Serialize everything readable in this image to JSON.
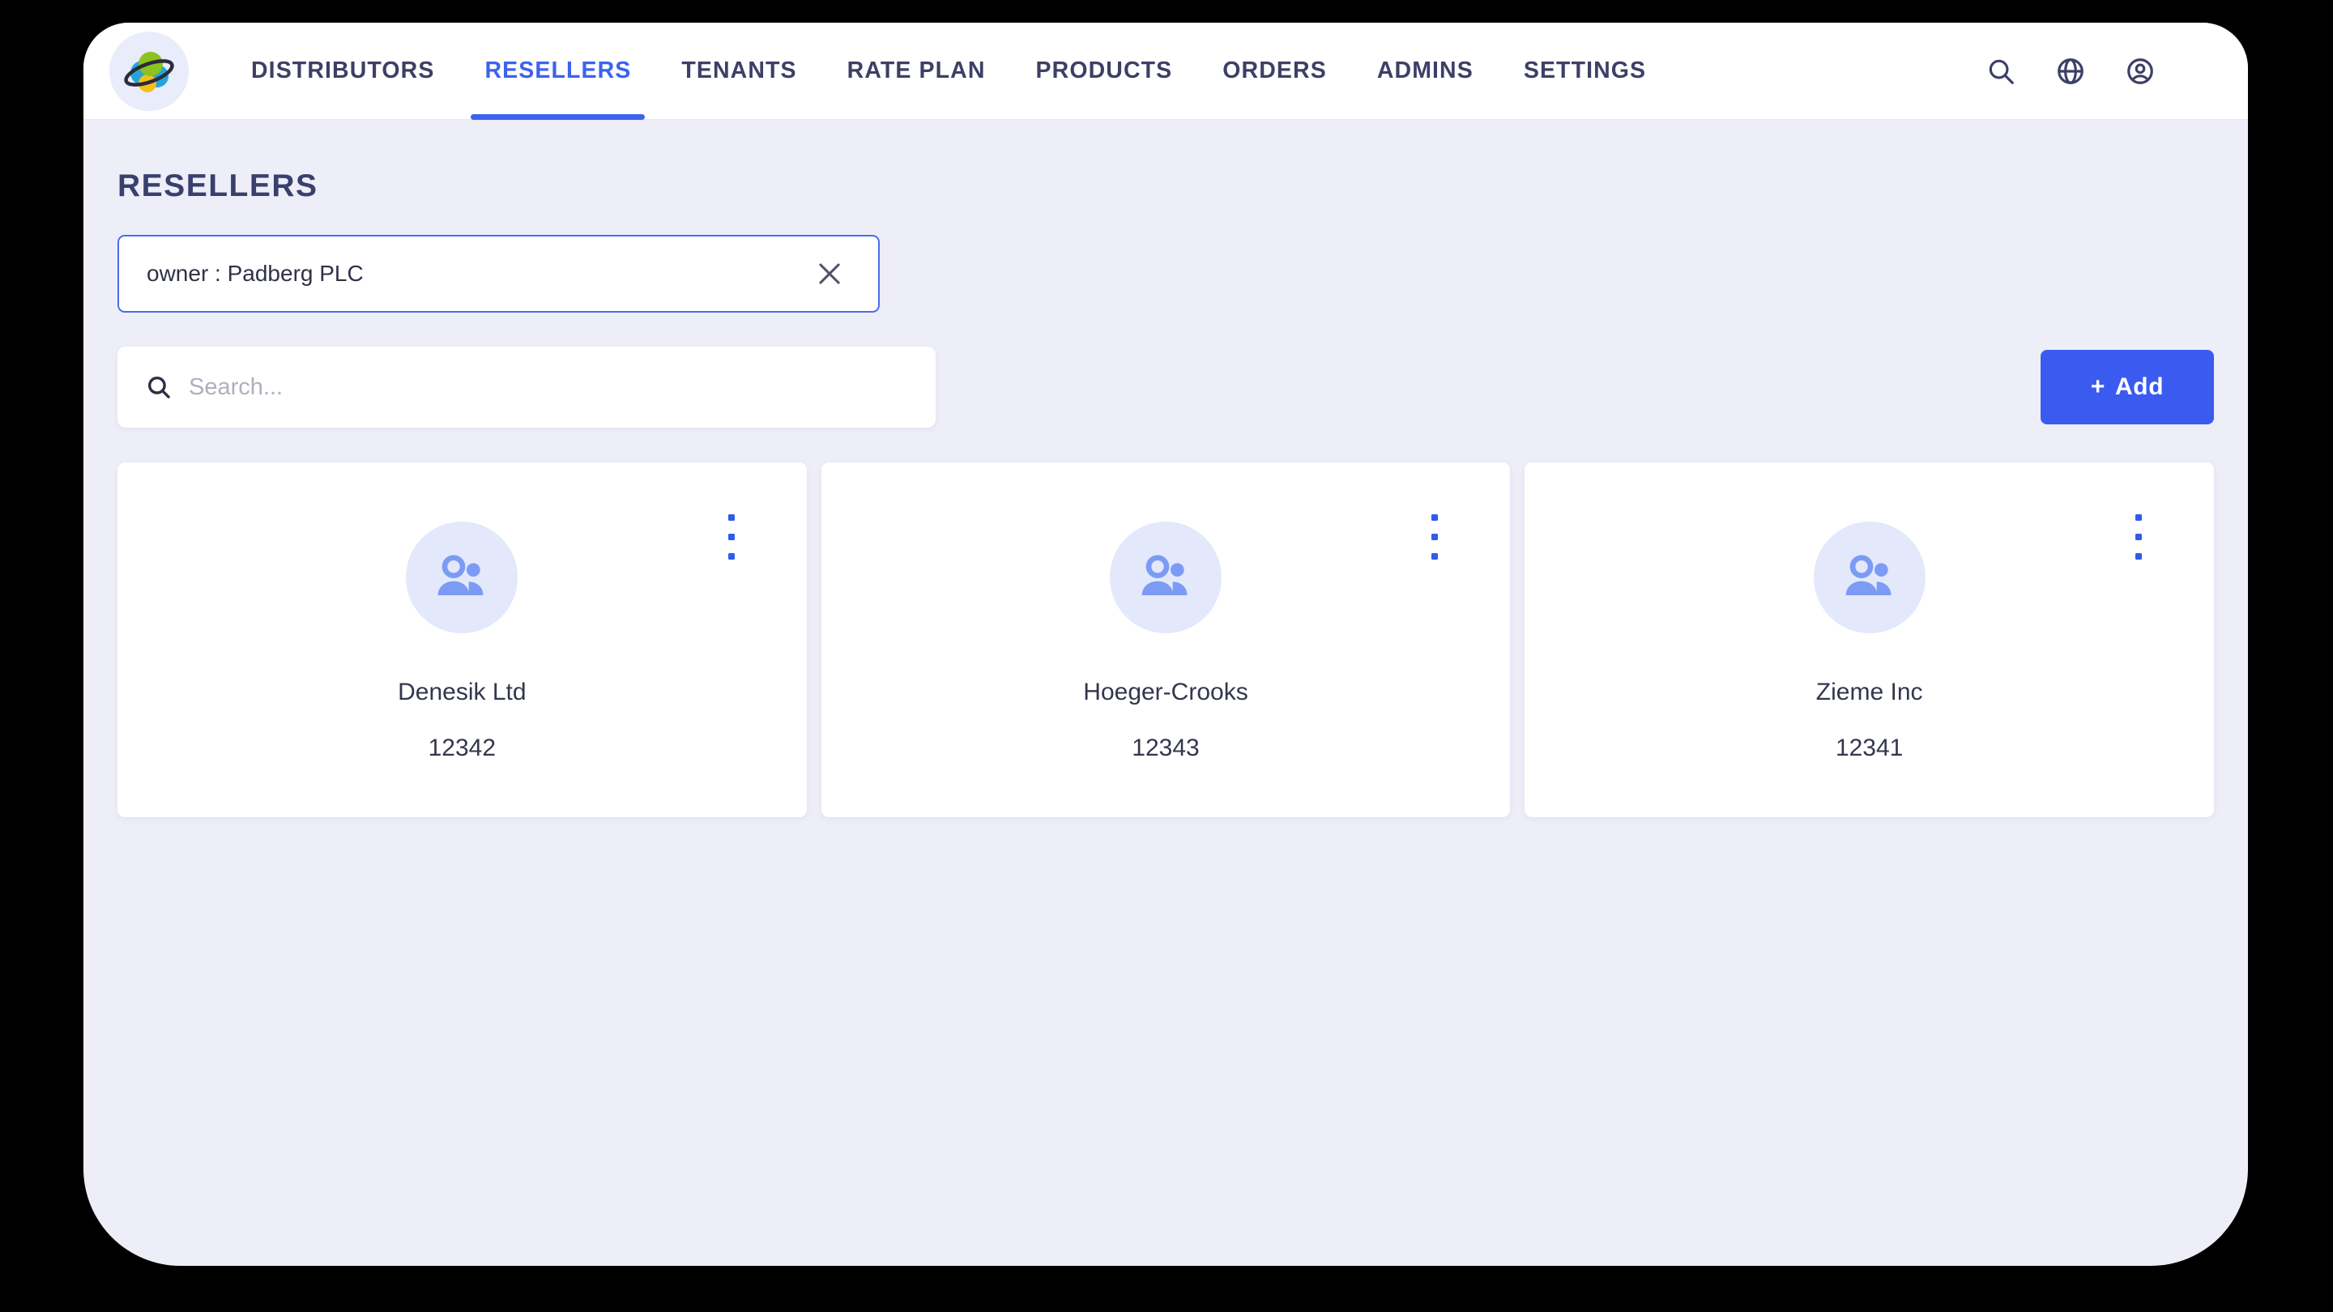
{
  "theme": {
    "accent_blue": "#3b5bf0",
    "nav_text": "#3d3f66",
    "page_bg": "#eeeef9",
    "card_bg": "#ffffff",
    "avatar_bg": "#e4e8fb",
    "avatar_icon": "#7b9bf5"
  },
  "topbar": {
    "logo_icon": "planet-orbit-logo-icon",
    "tabs": [
      {
        "label": "DISTRIBUTORS",
        "active": false
      },
      {
        "label": "RESELLERS",
        "active": true
      },
      {
        "label": "TENANTS",
        "active": false
      },
      {
        "label": "RATE PLAN",
        "active": false
      },
      {
        "label": "PRODUCTS",
        "active": false
      },
      {
        "label": "ORDERS",
        "active": false
      },
      {
        "label": "ADMINS",
        "active": false
      },
      {
        "label": "SETTINGS",
        "active": false
      }
    ],
    "actions": [
      {
        "icon": "search-icon"
      },
      {
        "icon": "globe-icon"
      },
      {
        "icon": "user-account-icon"
      }
    ]
  },
  "page": {
    "title": "RESELLERS"
  },
  "filter": {
    "chip_text": "owner : Padberg PLC",
    "clear_icon": "close-x-icon"
  },
  "search": {
    "placeholder": "Search...",
    "value": "",
    "icon": "search-icon"
  },
  "add_button": {
    "plus": "+",
    "label": "Add"
  },
  "cards": [
    {
      "name": "Denesik Ltd",
      "id": "12342",
      "avatar_icon": "people-group-icon",
      "menu_icon": "more-vertical-icon"
    },
    {
      "name": "Hoeger-Crooks",
      "id": "12343",
      "avatar_icon": "people-group-icon",
      "menu_icon": "more-vertical-icon"
    },
    {
      "name": "Zieme Inc",
      "id": "12341",
      "avatar_icon": "people-group-icon",
      "menu_icon": "more-vertical-icon"
    }
  ]
}
